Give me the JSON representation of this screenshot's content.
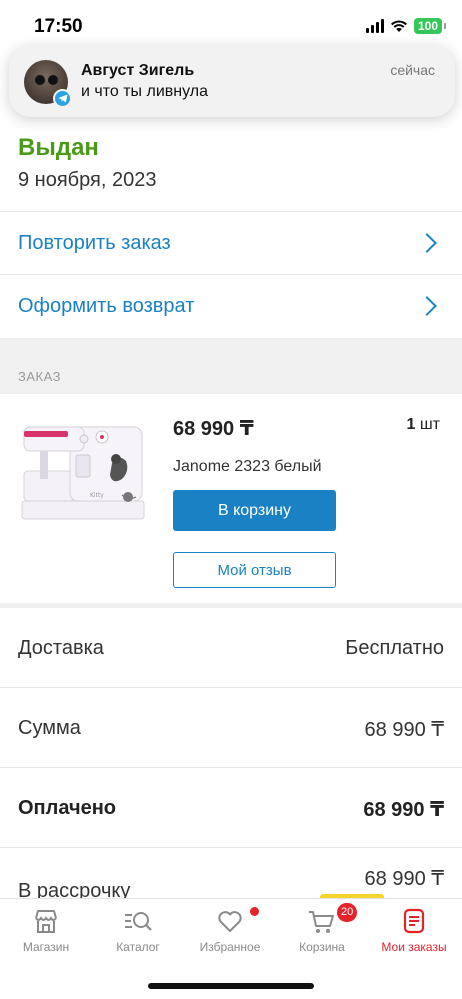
{
  "status_bar": {
    "time": "17:50",
    "battery": "100"
  },
  "notification": {
    "sender": "Август Зигель",
    "message": "и что ты ливнула",
    "time": "сейчас",
    "app_icon": "telegram-icon"
  },
  "order": {
    "status": "Выдан",
    "date": "9 ноября, 2023",
    "status_color": "#4c9a1a"
  },
  "actions": [
    {
      "label": "Повторить заказ"
    },
    {
      "label": "Оформить возврат"
    }
  ],
  "section_title": "ЗАКАЗ",
  "product": {
    "price": "68 990 ₸",
    "qty": "1",
    "qty_unit": "шт",
    "name": "Janome 2323 белый",
    "cart_button": "В корзину",
    "review_button": "Мой отзыв"
  },
  "summary": [
    {
      "label": "Доставка",
      "value": "Бесплатно"
    },
    {
      "label": "Сумма",
      "value": "68 990 ₸"
    },
    {
      "label": "Оплачено",
      "value": "68 990 ₸"
    },
    {
      "label": "В рассрочку",
      "value": "68 990 ₸"
    }
  ],
  "tab_bar": {
    "tabs": [
      {
        "label": "Магазин",
        "icon": "store-icon"
      },
      {
        "label": "Каталог",
        "icon": "catalog-search-icon"
      },
      {
        "label": "Избранное",
        "icon": "heart-icon"
      },
      {
        "label": "Корзина",
        "icon": "cart-icon",
        "badge": "20"
      },
      {
        "label": "Мои заказы",
        "icon": "orders-icon"
      }
    ],
    "active_index": 4
  },
  "colors": {
    "accent": "#1a82c4",
    "active_tab": "#e4232b",
    "status_green": "#4c9a1a"
  }
}
